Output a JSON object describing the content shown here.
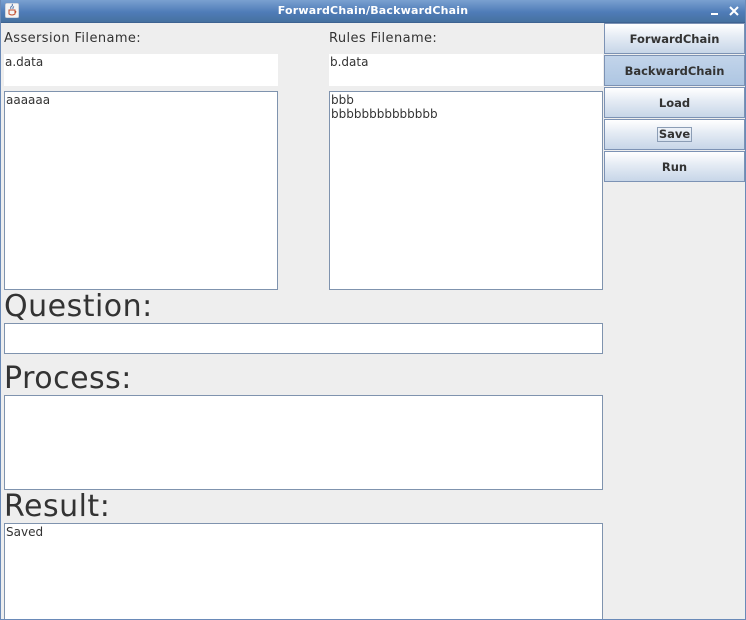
{
  "window": {
    "title": "ForwardChain/BackwardChain",
    "icon": "java-coffee-cup-icon",
    "controls": [
      "minimize-icon",
      "close-icon"
    ]
  },
  "assertion": {
    "label": "Assersion Filename:",
    "filename": "a.data",
    "content": "aaaaaa"
  },
  "rules": {
    "label": "Rules Filename:",
    "filename": "b.data",
    "content": "bbb\nbbbbbbbbbbbbbb"
  },
  "question": {
    "label": "Question:",
    "value": ""
  },
  "process": {
    "label": "Process:",
    "value": ""
  },
  "result": {
    "label": "Result:",
    "value": "Saved"
  },
  "buttons": {
    "forward": "ForwardChain",
    "backward": "BackwardChain",
    "load": "Load",
    "save": "Save",
    "run": "Run"
  },
  "colors": {
    "titlebar": "#4f7cb8",
    "background": "#eeeeee",
    "field_border": "#7f93ae",
    "button_pressed": "#aec6e2"
  }
}
